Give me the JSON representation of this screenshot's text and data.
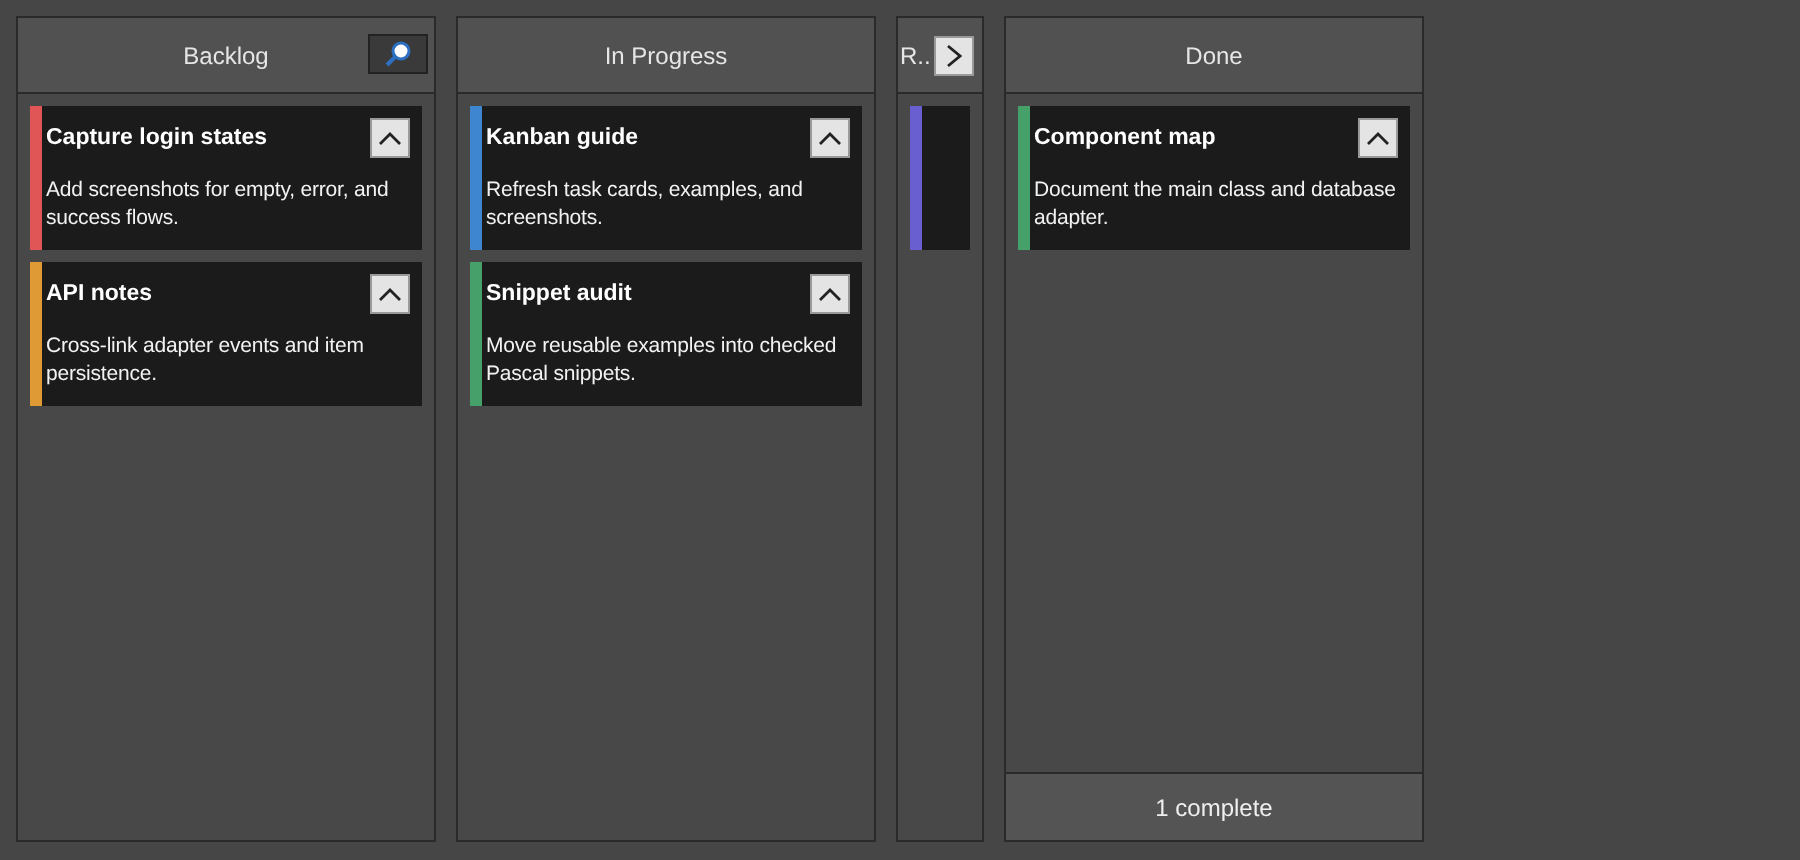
{
  "columns": [
    {
      "kind": "normal",
      "title": "Backlog",
      "search": true,
      "cards": [
        {
          "title": "Capture login states",
          "description": "Add screenshots for empty, error, and success flows.",
          "color": "#e05555",
          "expanded": true
        },
        {
          "title": "API notes",
          "description": "Cross-link adapter events and item persistence.",
          "color": "#e09a35",
          "expanded": true
        }
      ]
    },
    {
      "kind": "normal",
      "title": "In Progress",
      "cards": [
        {
          "title": "Kanban guide",
          "description": "Refresh task cards, examples, and screenshots.",
          "color": "#3f86d0",
          "expanded": true
        },
        {
          "title": "Snippet audit",
          "description": "Move reusable examples into checked Pascal snippets.",
          "color": "#45a06a",
          "expanded": true
        }
      ]
    },
    {
      "kind": "collapsed",
      "title": "R..",
      "cards": [
        {
          "color": "#6a5fd0"
        }
      ]
    },
    {
      "kind": "normal",
      "title": "Done",
      "footer": "1 complete",
      "cards": [
        {
          "title": "Component map",
          "description": "Document the main class and database adapter.",
          "color": "#45a06a",
          "expanded": true
        }
      ]
    }
  ]
}
